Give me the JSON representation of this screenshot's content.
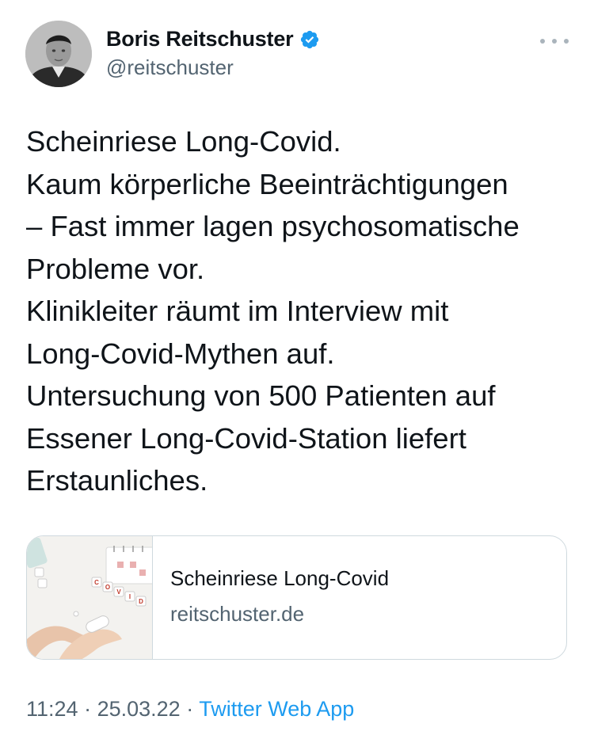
{
  "author": {
    "display_name": "Boris Reitschuster",
    "handle": "@reitschuster",
    "verified": true,
    "avatar_icon": "profile-photo"
  },
  "tweet": {
    "lines": [
      "Scheinriese Long-Covid.",
      "Kaum körperliche Beeinträchtigungen",
      "– Fast immer lagen psychosomatische",
      "Probleme vor.",
      "Klinikleiter räumt im Interview mit",
      "Long-Covid-Mythen auf.",
      "Untersuchung von 500 Patienten auf",
      "Essener Long-Covid-Station liefert",
      "Erstaunliches."
    ]
  },
  "link_card": {
    "title": "Scheinriese Long-Covid",
    "domain": "reitschuster.de",
    "thumbnail_letters": [
      "C",
      "O",
      "V",
      "I",
      "D"
    ]
  },
  "meta": {
    "time": "11:24",
    "separator": "·",
    "date": "25.03.22",
    "source": "Twitter Web App"
  },
  "colors": {
    "text": "#0f1419",
    "secondary": "#536471",
    "accent": "#1d9bf0",
    "border": "#cfd9de"
  }
}
